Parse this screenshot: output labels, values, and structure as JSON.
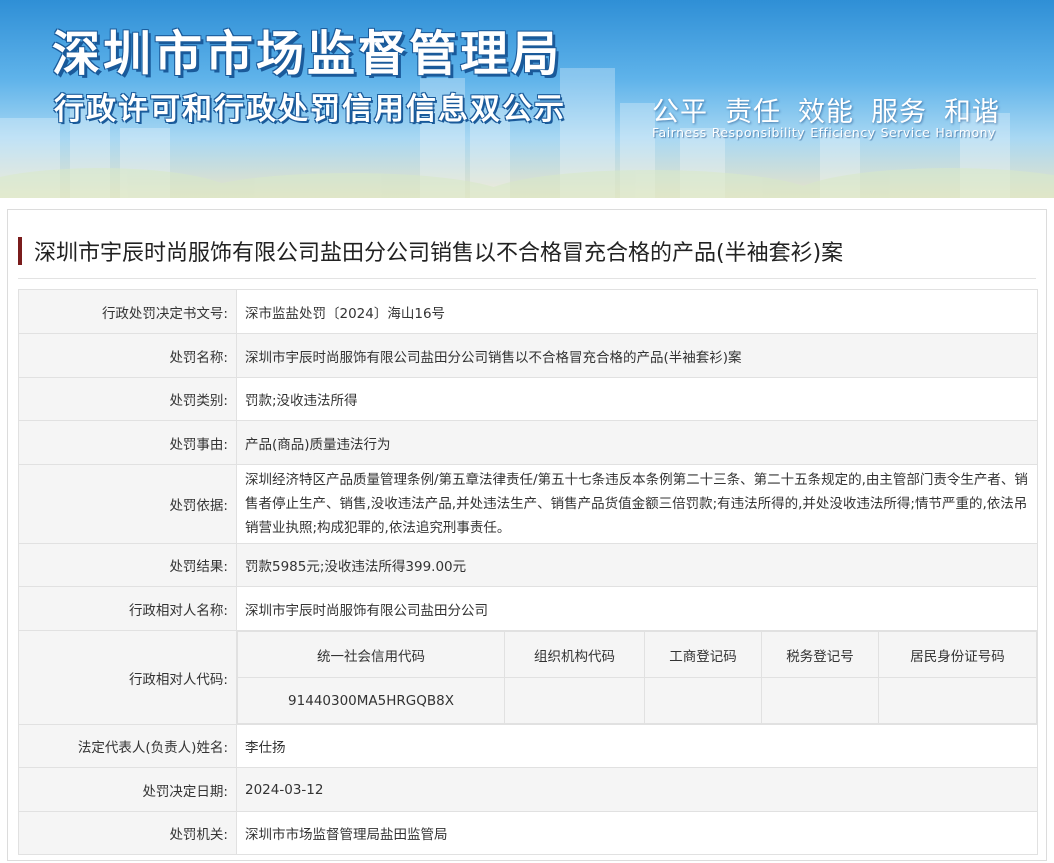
{
  "banner": {
    "title": "深圳市市场监督管理局",
    "subtitle": "行政许可和行政处罚信用信息双公示",
    "slogan_cn": [
      "公平",
      "责任",
      "效能",
      "服务",
      "和谐"
    ],
    "slogan_en": [
      "Fairness",
      "Responsibility",
      "Efficiency",
      "Service",
      "Harmony"
    ]
  },
  "case": {
    "title": "深圳市宇辰时尚服饰有限公司盐田分公司销售以不合格冒充合格的产品(半袖套衫)案"
  },
  "fields": {
    "decision_no_label": "行政处罚决定书文号:",
    "decision_no": "深市监盐处罚〔2024〕海山16号",
    "name_label": "处罚名称:",
    "name": "深圳市宇辰时尚服饰有限公司盐田分公司销售以不合格冒充合格的产品(半袖套衫)案",
    "type_label": "处罚类别:",
    "type": "罚款;没收违法所得",
    "reason_label": "处罚事由:",
    "reason": "产品(商品)质量违法行为",
    "basis_label": "处罚依据:",
    "basis": "深圳经济特区产品质量管理条例/第五章法律责任/第五十七条违反本条例第二十三条、第二十五条规定的,由主管部门责令生产者、销售者停止生产、销售,没收违法产品,并处违法生产、销售产品货值金额三倍罚款;有违法所得的,并处没收违法所得;情节严重的,依法吊销营业执照;构成犯罪的,依法追究刑事责任。",
    "result_label": "处罚结果:",
    "result": "罚款5985元;没收违法所得399.00元",
    "party_label": "行政相对人名称:",
    "party": "深圳市宇辰时尚服饰有限公司盐田分公司",
    "code_label": "行政相对人代码:",
    "code_headers": [
      "统一社会信用代码",
      "组织机构代码",
      "工商登记码",
      "税务登记号",
      "居民身份证号码"
    ],
    "code_values": [
      "91440300MA5HRGQB8X",
      "",
      "",
      "",
      ""
    ],
    "rep_label": "法定代表人(负责人)姓名:",
    "rep": "李仕扬",
    "date_label": "处罚决定日期:",
    "date": "2024-03-12",
    "authority_label": "处罚机关:",
    "authority": "深圳市市场监督管理局盐田监管局"
  },
  "colors": {
    "title_bar": "#7a1c1c",
    "label_bg": "#f5f5f5",
    "border": "#e1e1e1"
  }
}
